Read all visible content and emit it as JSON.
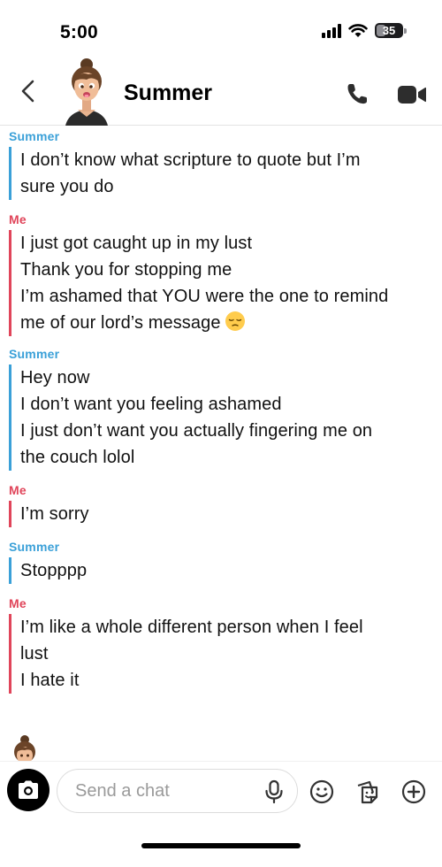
{
  "status_bar": {
    "time": "5:00",
    "battery": "35",
    "battery_level": 0.35,
    "signal_icon": "cellular-signal-icon",
    "wifi_icon": "wifi-icon"
  },
  "header": {
    "title": "Summer",
    "back_icon": "chevron-left-icon",
    "call_icon": "phone-icon",
    "video_icon": "video-camera-icon"
  },
  "colors": {
    "summer": "#3aa0d8",
    "me": "#e0455a"
  },
  "messages": [
    {
      "sender": "Summer",
      "lines": [
        "I don’t know what scripture to quote but I’m",
        "sure you do"
      ]
    },
    {
      "sender": "Me",
      "lines": [
        "I just got caught up in my lust",
        "Thank you for stopping me",
        "I’m ashamed that YOU were the one to remind",
        "me of our lord’s message"
      ],
      "emoji": "pensive-face-emoji"
    },
    {
      "sender": "Summer",
      "lines": [
        "Hey now",
        "I don’t want you feeling ashamed",
        "I just don’t want you actually fingering me on",
        "the couch lolol"
      ]
    },
    {
      "sender": "Me",
      "lines": [
        "I’m sorry"
      ]
    },
    {
      "sender": "Summer",
      "lines": [
        "Stopppp"
      ]
    },
    {
      "sender": "Me",
      "lines": [
        "I’m like a whole different person when I feel",
        "lust",
        "I hate it"
      ]
    }
  ],
  "composer": {
    "placeholder": "Send a chat",
    "camera_icon": "camera-icon",
    "mic_icon": "microphone-icon",
    "smile_icon": "smiley-icon",
    "sticker_icon": "sticker-icon",
    "plus_icon": "plus-icon"
  }
}
